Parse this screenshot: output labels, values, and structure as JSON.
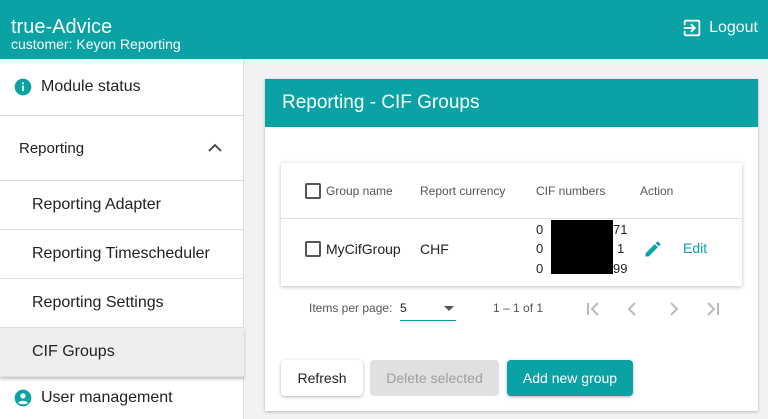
{
  "app": {
    "title": "true-Advice",
    "subtitle": "customer: Keyon Reporting",
    "logout_label": "Logout"
  },
  "sidebar": {
    "module_status": "Module status",
    "reporting": "Reporting",
    "sub_items": [
      "Reporting Adapter",
      "Reporting Timescheduler",
      "Reporting Settings",
      "CIF Groups"
    ],
    "user_management": "User management"
  },
  "main": {
    "title": "Reporting - CIF Groups",
    "table": {
      "columns": [
        "Group name",
        "Report currency",
        "CIF numbers",
        "Action"
      ],
      "rows": [
        {
          "group_name": "MyCifGroup",
          "currency": "CHF",
          "cif_numbers": [
            "0 71",
            "0 1",
            "0 99"
          ],
          "cif_prefix": [
            "0",
            "0",
            "0"
          ],
          "cif_suffix": [
            "71",
            "1",
            "99"
          ],
          "action": "Edit"
        }
      ]
    },
    "paginator": {
      "items_per_page_label": "Items per page:",
      "page_size": "5",
      "range": "1 – 1 of 1"
    },
    "buttons": {
      "refresh": "Refresh",
      "delete_selected": "Delete selected",
      "add_new_group": "Add new group"
    }
  },
  "colors": {
    "accent": "#0aa2a5",
    "disabled_bg": "#e0e0e0",
    "disabled_text": "#9e9e9e"
  }
}
